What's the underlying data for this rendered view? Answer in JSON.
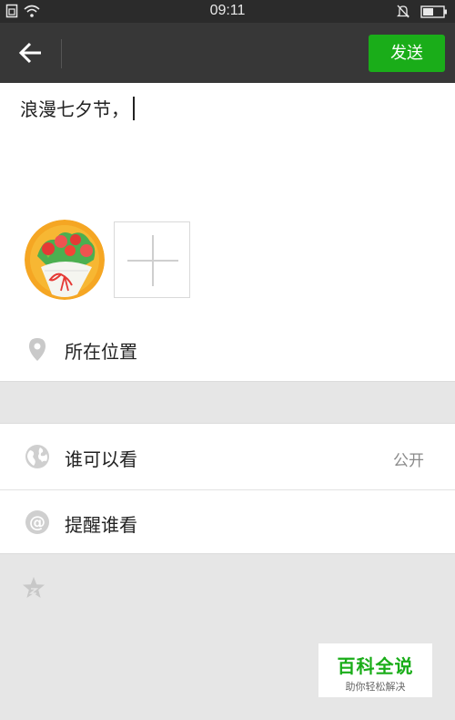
{
  "status_bar": {
    "time": "09:11"
  },
  "header": {
    "send_label": "发送"
  },
  "compose": {
    "text": "浪漫七夕节，"
  },
  "location": {
    "label": "所在位置"
  },
  "visibility": {
    "label": "谁可以看",
    "value": "公开"
  },
  "mention": {
    "label": "提醒谁看"
  },
  "watermark": {
    "title": "百科全说",
    "subtitle": "助你轻松解决"
  },
  "colors": {
    "accent": "#1aad19",
    "topbar": "#373737",
    "statusbar": "#2b2b2b",
    "background": "#e6e6e6"
  },
  "icons": [
    "back-arrow-icon",
    "location-pin-icon",
    "globe-icon",
    "at-icon",
    "star-icon",
    "add-photo-icon"
  ]
}
